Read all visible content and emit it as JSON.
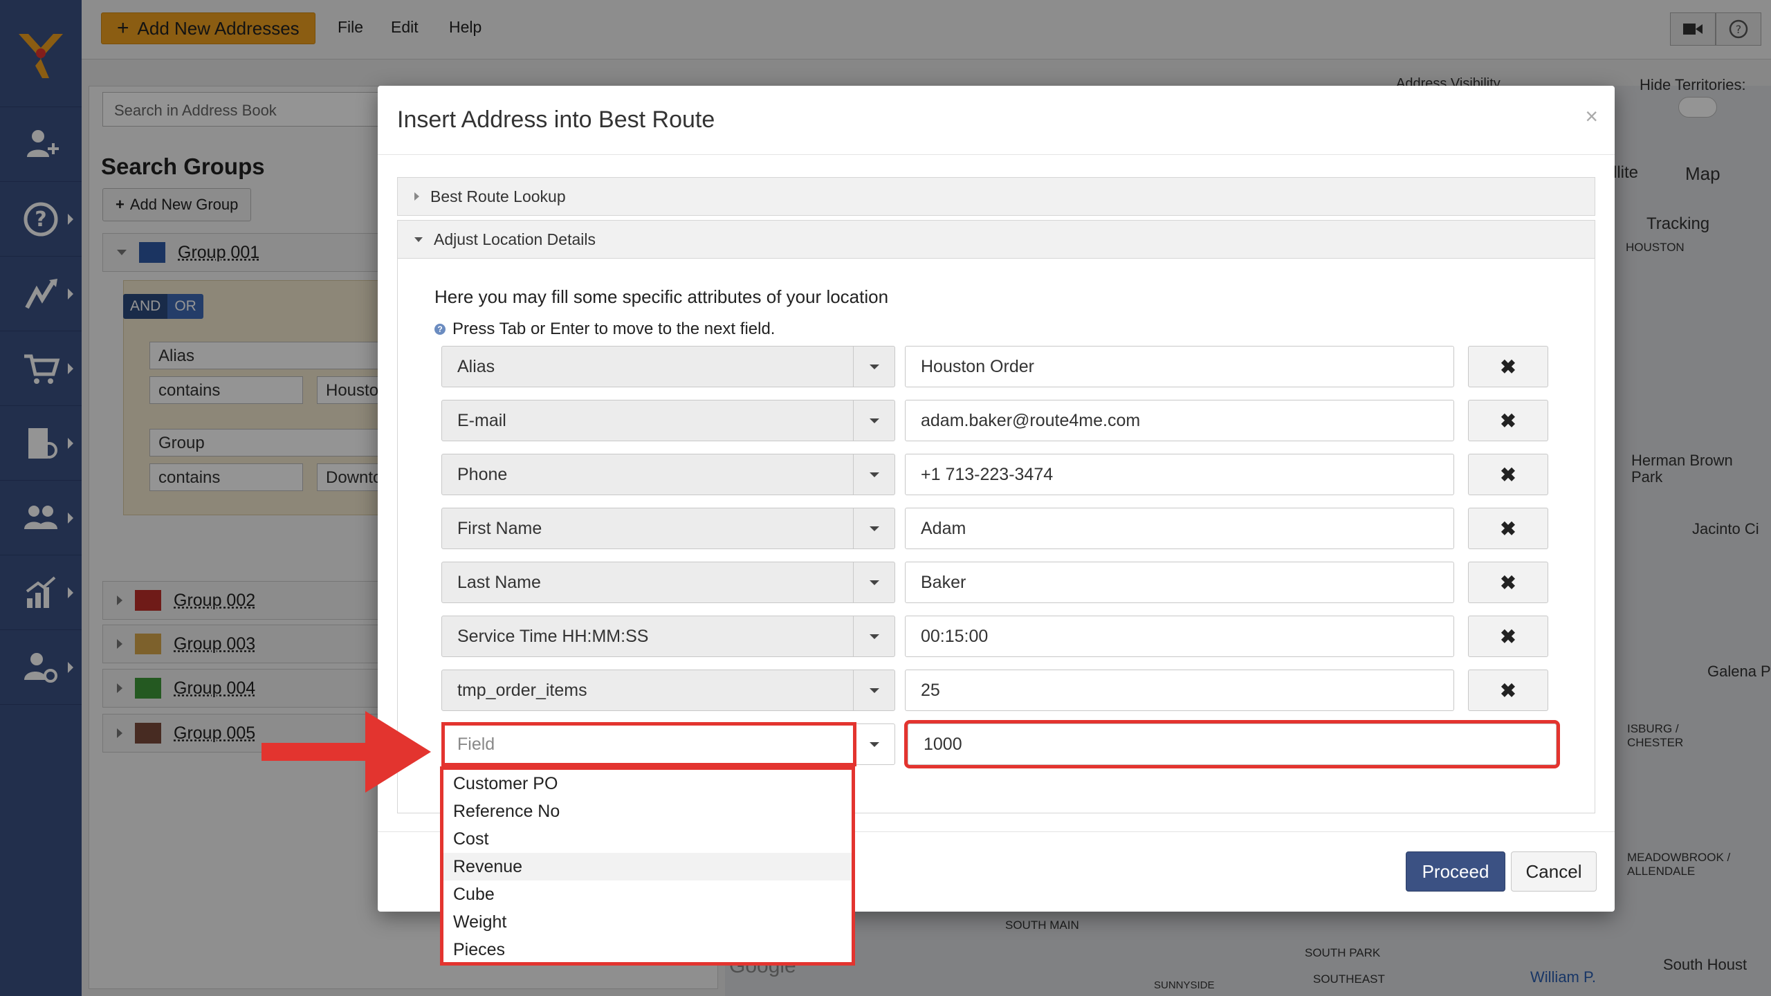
{
  "topbar": {
    "add_button": "Add New Addresses",
    "menu": [
      "File",
      "Edit",
      "Help"
    ]
  },
  "background": {
    "search_placeholder": "Search in Address Book",
    "search_groups_title": "Search Groups",
    "add_group_button": "Add New Group",
    "groups": [
      {
        "name": "Group 001",
        "color": "#2f5aa8"
      },
      {
        "name": "Group 002",
        "color": "#c0302a"
      },
      {
        "name": "Group 003",
        "color": "#d8a84c"
      },
      {
        "name": "Group 004",
        "color": "#3e9a3a"
      },
      {
        "name": "Group 005",
        "color": "#7a4a3c"
      }
    ],
    "filter": {
      "and": "AND",
      "or": "OR",
      "row1_field": "Alias",
      "row1_op": "contains",
      "row1_value": "Housto",
      "row2_field": "Group",
      "row2_op": "contains",
      "row2_value": "Downto"
    },
    "map": {
      "address_visibility": "Address Visibility",
      "hide_territories": "Hide Territories:",
      "satellite": "llite",
      "map_btn": "Map",
      "tracking": "Tracking",
      "labels": [
        "HOUSTON",
        "Herman Brown Park",
        "Jacinto Ci",
        "Galena P",
        "ISBURG / CHESTER",
        "MEADOWBROOK / ALLENDALE",
        "SOUTH MAIN",
        "SOUTH PARK",
        "SOUTHEAST",
        "William P.",
        "South Houst",
        "SUNNYSIDE",
        "Google"
      ]
    }
  },
  "modal": {
    "title": "Insert Address into Best Route",
    "close": "×",
    "accordion_1": "Best Route Lookup",
    "accordion_2": "Adjust Location Details",
    "intro": "Here you may fill some specific attributes of your location",
    "hint": "Press Tab or Enter to move to the next field.",
    "hint_icon": "?",
    "delete_glyph": "✖",
    "rows": [
      {
        "field": "Alias",
        "value": "Houston Order"
      },
      {
        "field": "E-mail",
        "value": "adam.baker@route4me.com"
      },
      {
        "field": "Phone",
        "value": "+1 713-223-3474"
      },
      {
        "field": "First Name",
        "value": "Adam"
      },
      {
        "field": "Last Name",
        "value": "Baker"
      },
      {
        "field": "Service Time HH:MM:SS",
        "value": "00:15:00"
      },
      {
        "field": "tmp_order_items",
        "value": "25"
      }
    ],
    "new_row": {
      "field_placeholder": "Field",
      "value": "1000"
    },
    "dropdown_options": [
      "Customer PO",
      "Reference No",
      "Cost",
      "Revenue",
      "Cube",
      "Weight",
      "Pieces"
    ],
    "proceed": "Proceed",
    "cancel": "Cancel"
  },
  "colors": {
    "nav_bg": "#3b5183",
    "accent_orange": "#f0a020",
    "highlight_red": "#e3342f"
  }
}
